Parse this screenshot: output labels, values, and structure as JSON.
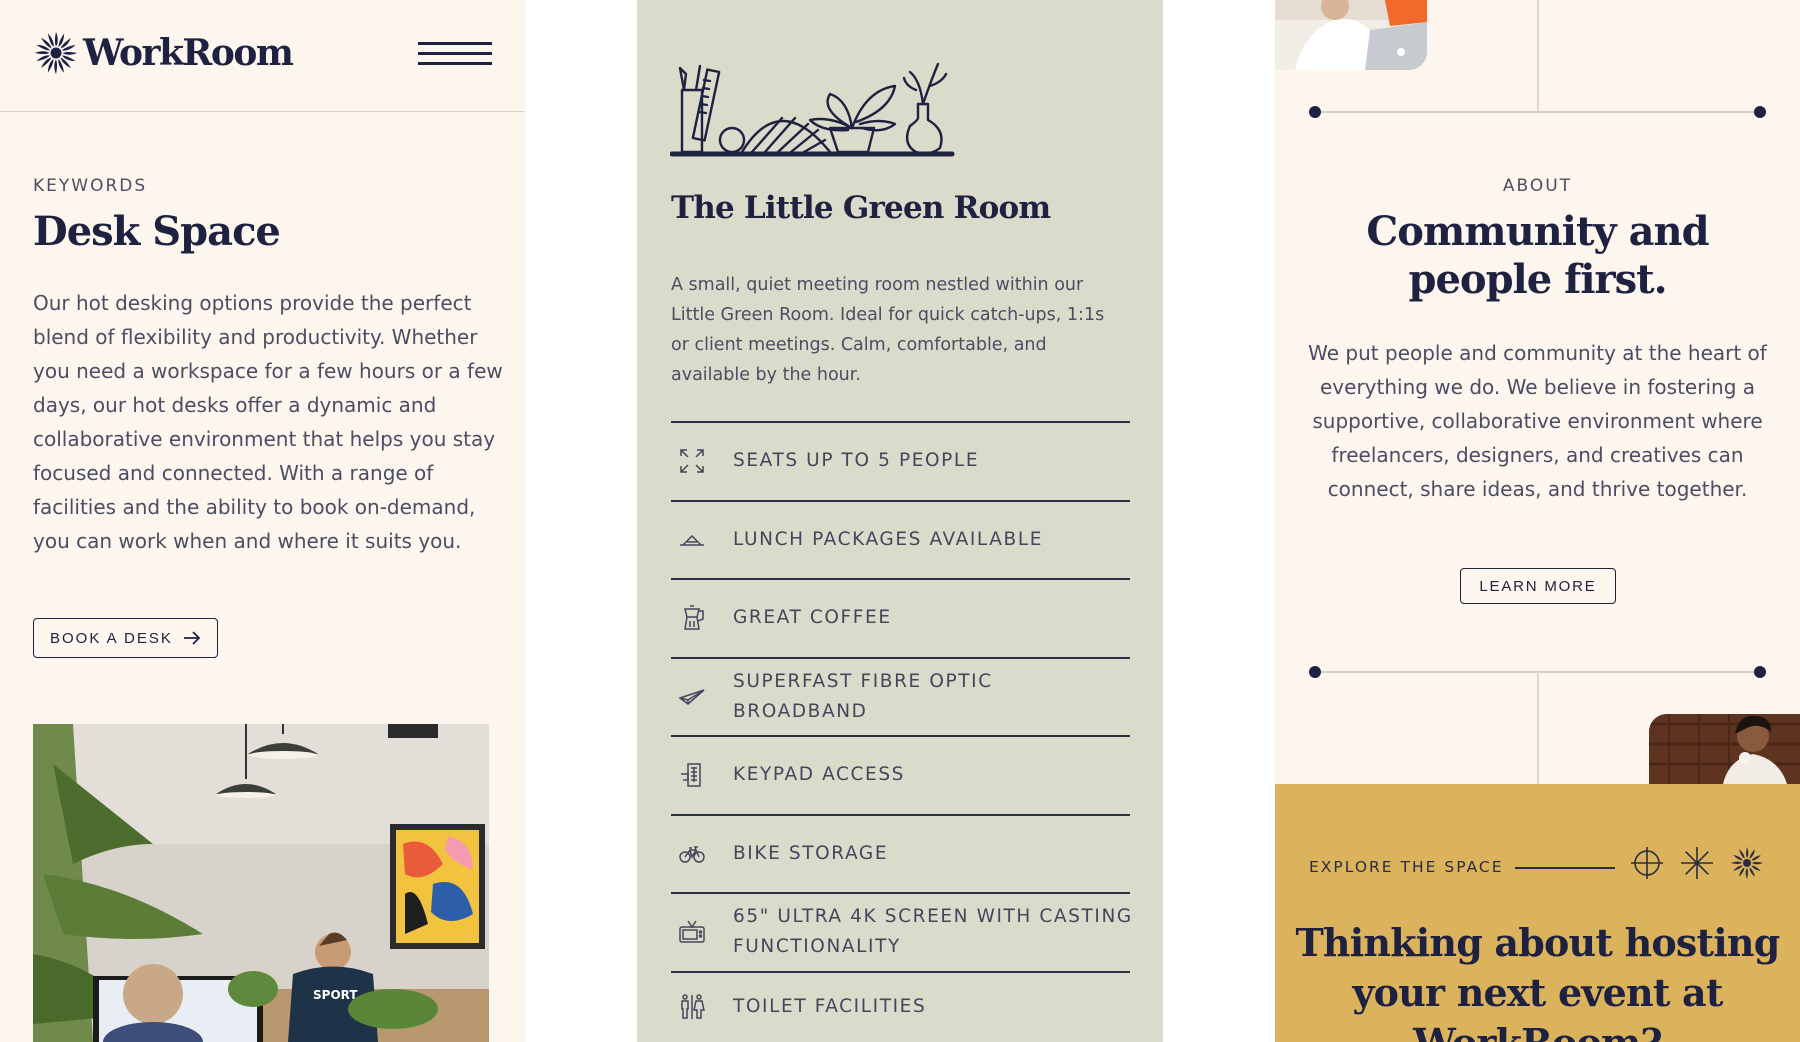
{
  "brand": {
    "name": "WorkRoom"
  },
  "desk": {
    "kicker": "KEYWORDS",
    "title": "Desk Space",
    "body": "Our hot desking options provide the perfect blend of flexibility and productivity. Whether you need a workspace for a few hours or a few days, our hot desks offer a dynamic and collaborative environment that helps you stay focused and connected. With a range of facilities and the ability to book on-demand, you can work when and where it suits you.",
    "cta": "BOOK A DESK"
  },
  "room": {
    "title": "The Little Green Room",
    "description": "A small, quiet meeting room nestled within our Little Green Room. Ideal for quick catch-ups, 1:1s or client meetings. Calm, comfortable, and available by the hour.",
    "features": [
      {
        "label": "SEATS UP TO 5 PEOPLE",
        "icon": "expand-icon"
      },
      {
        "label": "LUNCH PACKAGES AVAILABLE",
        "icon": "cloche-icon"
      },
      {
        "label": "GREAT COFFEE",
        "icon": "coffee-pot-icon"
      },
      {
        "label": "SUPERFAST FIBRE OPTIC BROADBAND",
        "icon": "paper-plane-icon"
      },
      {
        "label": "KEYPAD ACCESS",
        "icon": "keypad-icon"
      },
      {
        "label": "BIKE STORAGE",
        "icon": "bike-icon"
      },
      {
        "label": "65\" ULTRA 4K SCREEN WITH CASTING FUNCTIONALITY",
        "icon": "tv-icon"
      },
      {
        "label": "TOILET FACILITIES",
        "icon": "toilet-icon"
      }
    ]
  },
  "about": {
    "kicker": "ABOUT",
    "title": "Community and people first.",
    "body": "We put people and community at the heart of everything we do. We believe in fostering a supportive, collaborative environment where freelancers, designers, and creatives can connect, share ideas, and thrive together.",
    "cta": "LEARN MORE"
  },
  "explore": {
    "kicker": "EXPLORE THE SPACE",
    "title": "Thinking about hosting your next event at WorkRoom?"
  },
  "colors": {
    "navy": "#1f2140",
    "cream": "#fdf6ee",
    "sage": "#dbdbcc",
    "mustard": "#dcb35d"
  }
}
